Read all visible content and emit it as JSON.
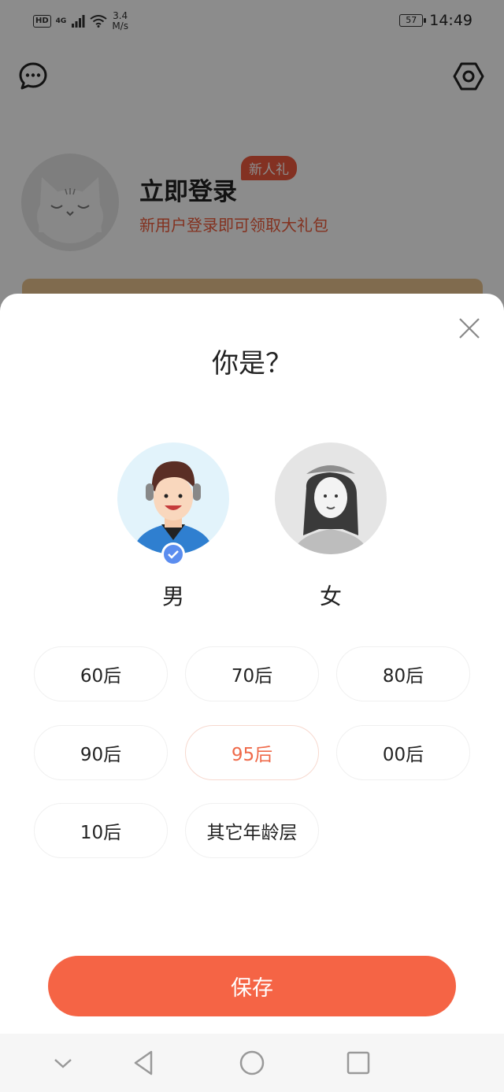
{
  "status_bar": {
    "network_hd": "HD",
    "network_4g": "4G",
    "speed_value": "3.4",
    "speed_unit": "M/s",
    "battery": "57",
    "time": "14:49"
  },
  "background": {
    "login_title": "立即登录",
    "new_user_badge": "新人礼",
    "login_subtitle": "新用户登录即可领取大礼包"
  },
  "dialog": {
    "title": "你是？",
    "genders": [
      {
        "label": "男",
        "selected": true
      },
      {
        "label": "女",
        "selected": false
      }
    ],
    "age_options": [
      {
        "label": "60后",
        "selected": false
      },
      {
        "label": "70后",
        "selected": false
      },
      {
        "label": "80后",
        "selected": false
      },
      {
        "label": "90后",
        "selected": false
      },
      {
        "label": "95后",
        "selected": true
      },
      {
        "label": "00后",
        "selected": false
      },
      {
        "label": "10后",
        "selected": false
      },
      {
        "label": "其它年龄层",
        "selected": false
      }
    ],
    "save_label": "保存"
  },
  "colors": {
    "accent": "#f56445",
    "selected_text": "#ef6a4a",
    "check_badge": "#5b8def"
  },
  "icons": [
    "message-icon",
    "settings-icon",
    "close-icon",
    "check-icon",
    "nav-back-icon",
    "nav-home-icon",
    "nav-recent-icon",
    "nav-collapse-icon"
  ]
}
